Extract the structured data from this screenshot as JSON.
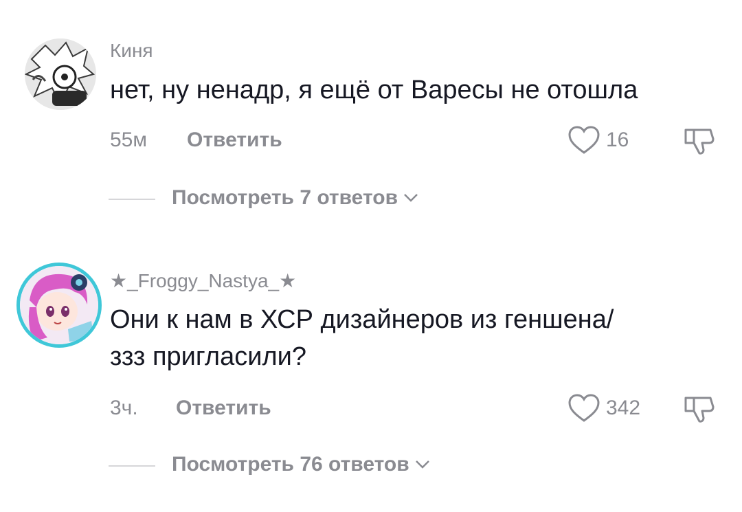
{
  "comments": [
    {
      "username": "Киня",
      "text_lines": [
        "нет, ну ненадр, я ещё от Варесы не отошла"
      ],
      "time": "55м",
      "reply_label": "Ответить",
      "likes": "16",
      "view_replies": "Посмотреть 7 ответов"
    },
    {
      "username": "★_Froggy_Nastya_★",
      "text_lines": [
        "Они к нам в ХСР дизайнеров из геншена/",
        "ззз пригласили?"
      ],
      "time": "3ч.",
      "reply_label": "Ответить",
      "likes": "342",
      "view_replies": "Посмотреть 76 ответов"
    }
  ],
  "icons": {
    "like": "heart-outline-icon",
    "dislike": "thumbs-down-icon",
    "expand": "chevron-down-icon"
  },
  "colors": {
    "text": "#161823",
    "secondary": "#8a8b91",
    "avatar_ring": "#3fc7d8"
  }
}
